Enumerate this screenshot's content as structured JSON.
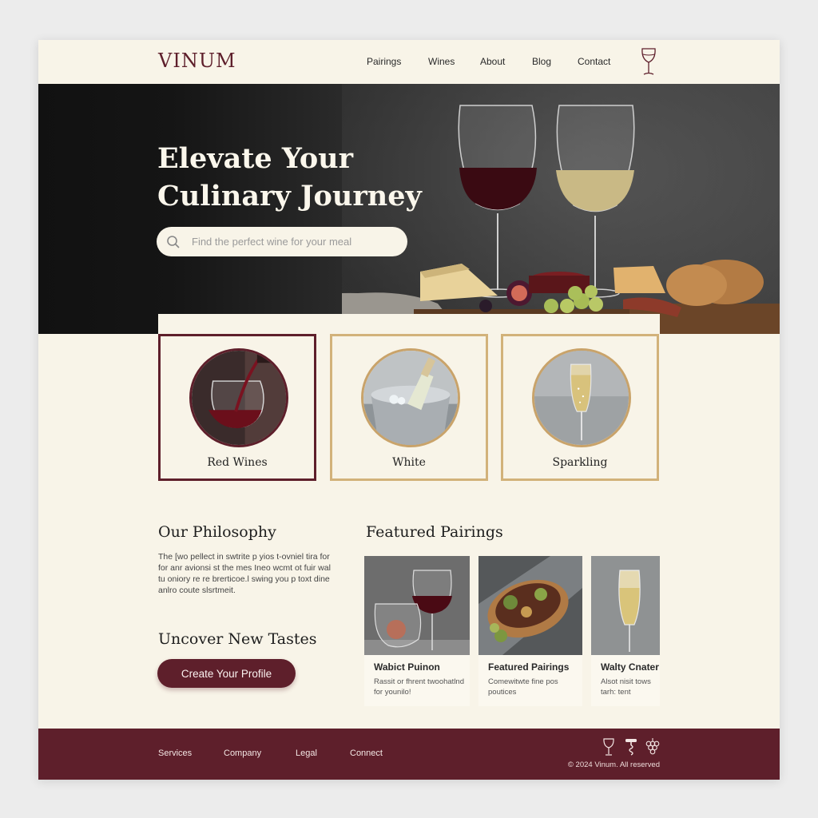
{
  "brand": {
    "name": "VINUM"
  },
  "nav": {
    "items": [
      "Pairings",
      "Wines",
      "About",
      "Blog",
      "Contact"
    ],
    "icon": "wine-glass-icon"
  },
  "hero": {
    "title": "Elevate Your Culinary Journey",
    "search_placeholder": "Find the perfect wine for your meal",
    "search_value": ""
  },
  "categories": [
    {
      "label": "Red Wines",
      "active": true
    },
    {
      "label": "White",
      "active": false
    },
    {
      "label": "Sparkling",
      "active": false
    }
  ],
  "philosophy": {
    "heading": "Our Philosophy",
    "text": "The [wo pellect in swtrite p yios t-ovniel tira for for anr avionsi st the mes Ineo wcmt ot fuir wal tu oniory re re brerticoe.l swing you p toxt dine anlro coute slsrtmeit."
  },
  "discover": {
    "heading": "Uncover New Tastes",
    "cta": "Create Your Profile"
  },
  "featured": {
    "heading": "Featured Pairings",
    "cards": [
      {
        "title": "Wabict Puinon",
        "desc": "Rassit or fhrent twoohatlnd for younilo!"
      },
      {
        "title": "Featured Pairings",
        "desc": "Comewitwte fine pos poutices"
      },
      {
        "title": "Walty Cnater",
        "desc": "Alsot nisit tows tarh: tent"
      }
    ]
  },
  "footer": {
    "links": [
      "Services",
      "Company",
      "Legal",
      "Connect"
    ],
    "icons": [
      "wine-glass-icon",
      "corkscrew-icon",
      "grapes-icon"
    ],
    "copyright": "© 2024 Vinum. All reserved"
  },
  "colors": {
    "accent": "#5e1f2b",
    "gold": "#d2b27a",
    "background": "#f8f4e8",
    "hero_dark": "#111111"
  }
}
